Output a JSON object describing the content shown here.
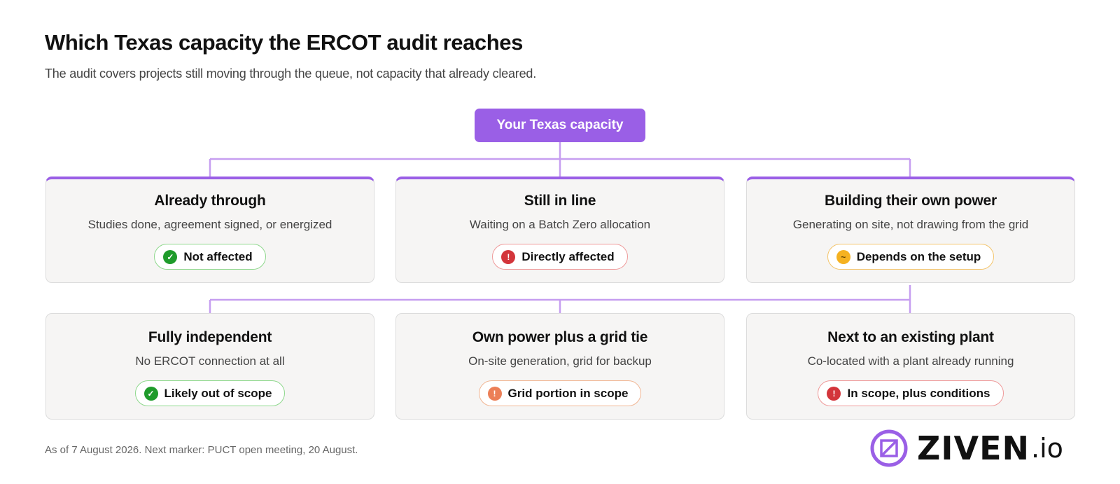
{
  "header": {
    "title": "Which Texas capacity the ERCOT audit reaches",
    "subtitle": "The audit covers projects still moving through the queue, not capacity that already cleared."
  },
  "root": {
    "label": "Your Texas capacity"
  },
  "top_cards": [
    {
      "title": "Already through",
      "description": "Studies done, agreement signed, or energized",
      "status": "Not affected",
      "status_icon": "check-icon",
      "status_color": "#1f9b2b"
    },
    {
      "title": "Still in line",
      "description": "Waiting on a Batch Zero allocation",
      "status": "Directly affected",
      "status_icon": "exclamation-icon",
      "status_color": "#d3353b"
    },
    {
      "title": "Building their own power",
      "description": "Generating on site, not drawing from the grid",
      "status": "Depends on the setup",
      "status_icon": "tilde-icon",
      "status_color": "#f5b221"
    }
  ],
  "bottom_cards": [
    {
      "title": "Fully independent",
      "description": "No ERCOT connection at all",
      "status": "Likely out of scope",
      "status_icon": "check-icon",
      "status_color": "#1f9b2b"
    },
    {
      "title": "Own power plus a grid tie",
      "description": "On-site generation, grid for backup",
      "status": "Grid portion in scope",
      "status_icon": "exclamation-icon",
      "status_color": "#ec7f57"
    },
    {
      "title": "Next to an existing plant",
      "description": "Co-located with a plant already running",
      "status": "In scope, plus conditions",
      "status_icon": "exclamation-icon",
      "status_color": "#d3353b"
    }
  ],
  "glyphs": {
    "check": "✓",
    "exclamation": "!",
    "tilde": "~"
  },
  "footer": {
    "note": "As of 7 August 2026. Next marker: PUCT open meeting, 20 August.",
    "brand": "ZIVEN",
    "brand_tld": ".io"
  },
  "colors": {
    "accent": "#9a5fe6",
    "connector": "#c69ef0"
  }
}
